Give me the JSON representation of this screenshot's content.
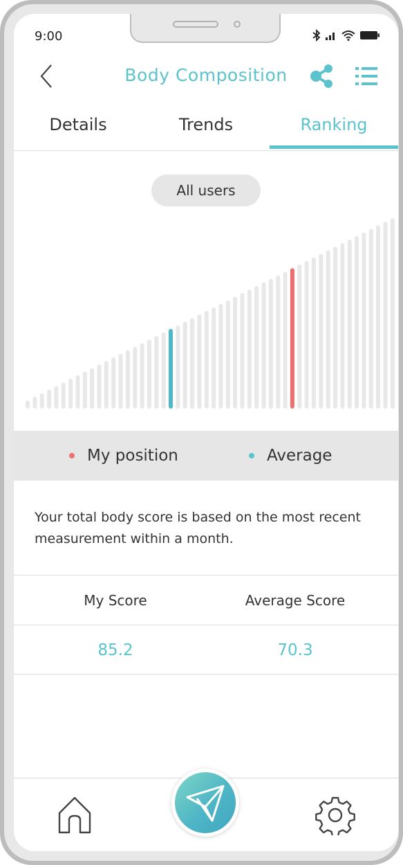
{
  "status_bar": {
    "time": "9:00"
  },
  "header": {
    "title": "Body Composition",
    "back_icon": "chevron-left-icon",
    "share_icon": "share-icon",
    "menu_icon": "list-menu-icon"
  },
  "tabs": [
    {
      "label": "Details",
      "active": false
    },
    {
      "label": "Trends",
      "active": false
    },
    {
      "label": "Ranking",
      "active": true
    }
  ],
  "filter": {
    "label": "All users"
  },
  "chart_data": {
    "type": "bar",
    "bar_count": 52,
    "my_position_bar": 37,
    "average_bar": 20,
    "colors": {
      "default": "#e8e8e8",
      "my_position": "#ec7070",
      "average": "#4fb8c4"
    }
  },
  "legend": [
    {
      "label": "My position",
      "color": "#ec7070"
    },
    {
      "label": "Average",
      "color": "#5bc3cc"
    }
  ],
  "info_text": "Your total body score is based on the most recent measurement within a month.",
  "scores": {
    "my_label": "My Score",
    "avg_label": "Average Score",
    "my_value": "85.2",
    "avg_value": "70.3"
  },
  "bottom_nav": {
    "home_icon": "home-icon",
    "center_icon": "send-icon",
    "settings_icon": "gear-icon"
  },
  "accent_color": "#5bc3cc"
}
